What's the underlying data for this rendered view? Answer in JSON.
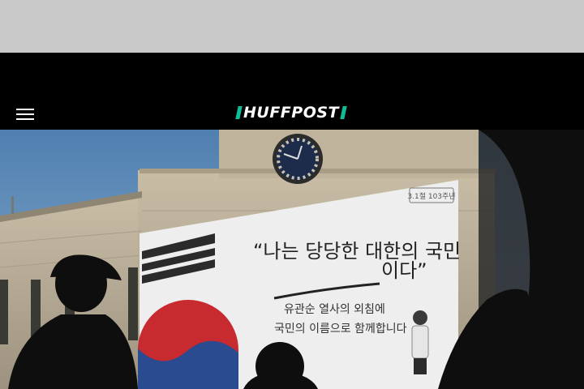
{
  "ad_slot": {},
  "header": {
    "logo_text": "HUFFPOST",
    "brand_color": "#0dbe98",
    "menu_icon": "hamburger-menu-icon"
  },
  "hero": {
    "banner": {
      "quote_line1": "“나는 당당한 대한의 국민",
      "quote_line2": "이다”",
      "subtitle_line1": "유관순 열사의 외침에",
      "subtitle_line2": "국민의 이름으로 함께합니다",
      "badge": "3.1절 103주년"
    }
  }
}
